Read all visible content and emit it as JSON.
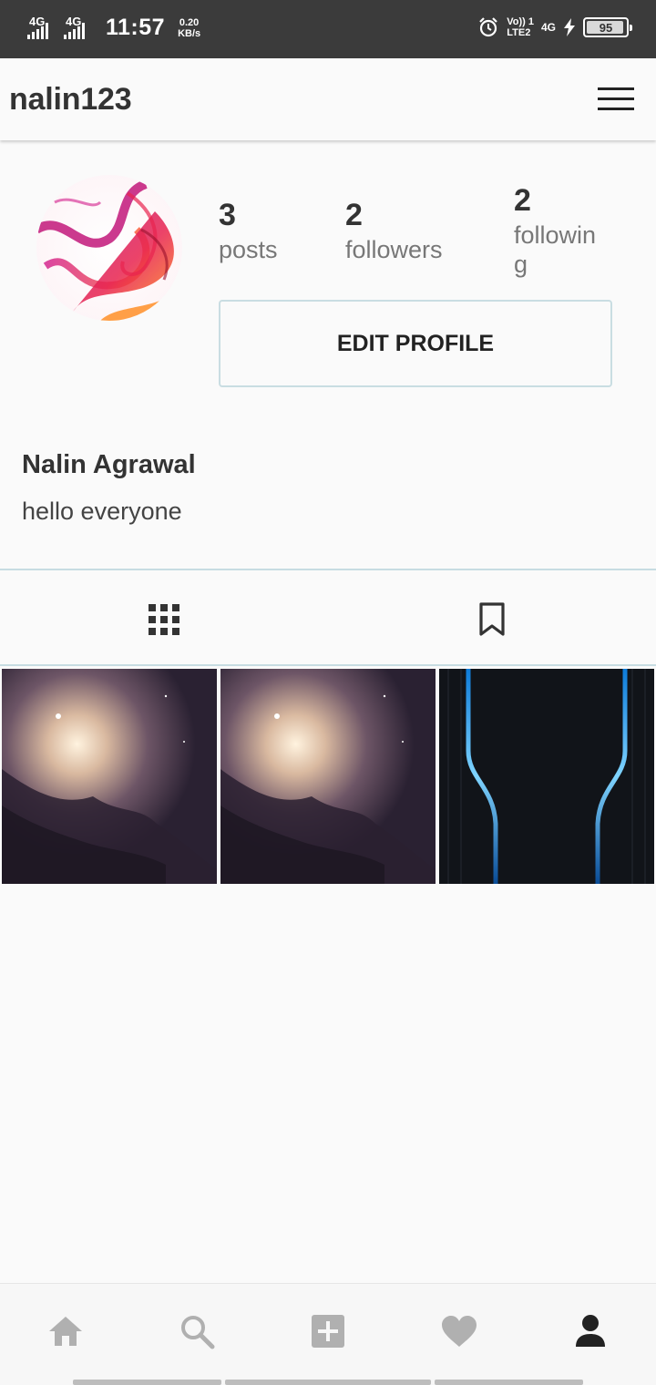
{
  "status_bar": {
    "sim1_network": "4G",
    "sim2_network": "4G",
    "time": "11:57",
    "net_speed_value": "0.20",
    "net_speed_unit": "KB/s",
    "volte_top": "Vo)) 1",
    "volte_bottom": "LTE2",
    "network_right": "4G",
    "battery_percent": "95",
    "battery_level": 0.95
  },
  "app_bar": {
    "username": "nalin123",
    "menu_icon": "hamburger-menu-icon"
  },
  "profile": {
    "avatar": "abstract-smoke-avatar",
    "stats": {
      "posts_count": "3",
      "posts_label": "posts",
      "followers_count": "2",
      "followers_label": "followers",
      "following_count": "2",
      "following_label_line1": "followin",
      "following_label_line2": "g"
    },
    "edit_button": "EDIT PROFILE",
    "full_name": "Nalin Agrawal",
    "bio": "hello everyone"
  },
  "tabs": [
    {
      "icon": "grid-icon",
      "active": true
    },
    {
      "icon": "bookmark-icon",
      "active": false
    }
  ],
  "posts": [
    {
      "thumbnail": "nebula-galaxy-image"
    },
    {
      "thumbnail": "nebula-galaxy-image"
    },
    {
      "thumbnail": "dark-blue-neon-lines-image"
    }
  ],
  "bottom_nav": [
    {
      "icon": "home-icon"
    },
    {
      "icon": "search-icon"
    },
    {
      "icon": "add-post-icon"
    },
    {
      "icon": "heart-icon"
    },
    {
      "icon": "profile-icon",
      "active": true
    }
  ],
  "colors": {
    "status_bar_bg": "#3b3b3b",
    "page_bg": "#fafafa",
    "divider": "#c7dce2",
    "inactive_icon": "#b0b0b0",
    "active_icon": "#222222"
  }
}
